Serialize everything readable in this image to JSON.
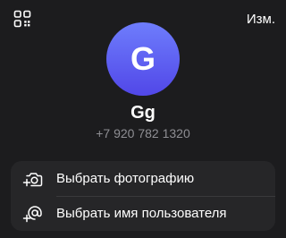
{
  "header": {
    "qr_icon": "qr-code-icon",
    "edit_label": "Изм."
  },
  "profile": {
    "avatar_initial": "G",
    "avatar_colors": [
      "#6e7dfc",
      "#5147e8"
    ],
    "name": "Gg",
    "phone": "+7 920 782 1320"
  },
  "actions": [
    {
      "icon": "camera-add-icon",
      "label": "Выбрать фотографию"
    },
    {
      "icon": "at-sign-add-icon",
      "label": "Выбрать имя пользователя"
    }
  ],
  "colors": {
    "background": "#1c1c1e",
    "card": "#262628",
    "secondary_text": "#8e8e93"
  }
}
